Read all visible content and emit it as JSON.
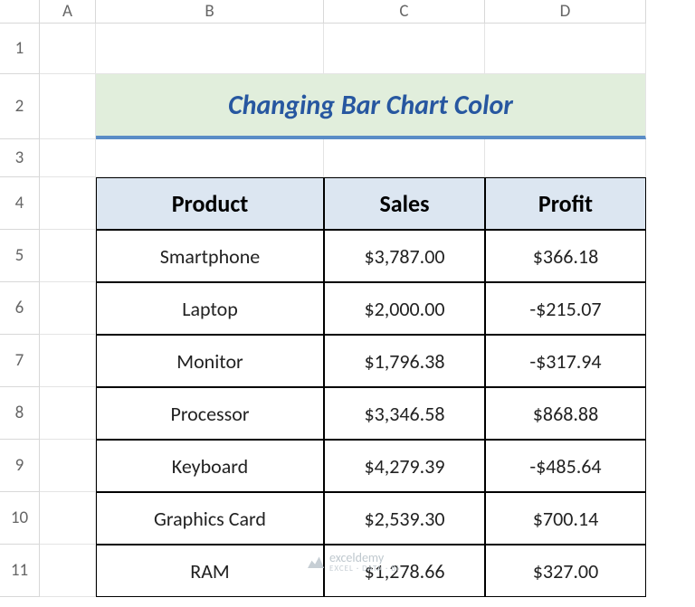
{
  "columns": [
    "A",
    "B",
    "C",
    "D"
  ],
  "rows": [
    "1",
    "2",
    "3",
    "4",
    "5",
    "6",
    "7",
    "8",
    "9",
    "10",
    "11"
  ],
  "title": "Changing Bar Chart Color",
  "table": {
    "headers": [
      "Product",
      "Sales",
      "Profit"
    ],
    "data": [
      {
        "product": "Smartphone",
        "sales": "$3,787.00",
        "profit": "$366.18"
      },
      {
        "product": "Laptop",
        "sales": "$2,000.00",
        "profit": "-$215.07"
      },
      {
        "product": "Monitor",
        "sales": "$1,796.38",
        "profit": "-$317.94"
      },
      {
        "product": "Processor",
        "sales": "$3,346.58",
        "profit": "$868.88"
      },
      {
        "product": "Keyboard",
        "sales": "$4,279.39",
        "profit": "-$485.64"
      },
      {
        "product": "Graphics Card",
        "sales": "$2,539.30",
        "profit": "$700.14"
      },
      {
        "product": "RAM",
        "sales": "$1,278.66",
        "profit": "$327.00"
      }
    ]
  },
  "watermark": {
    "brand": "exceldemy",
    "tagline": "EXCEL · DATA · BI"
  }
}
